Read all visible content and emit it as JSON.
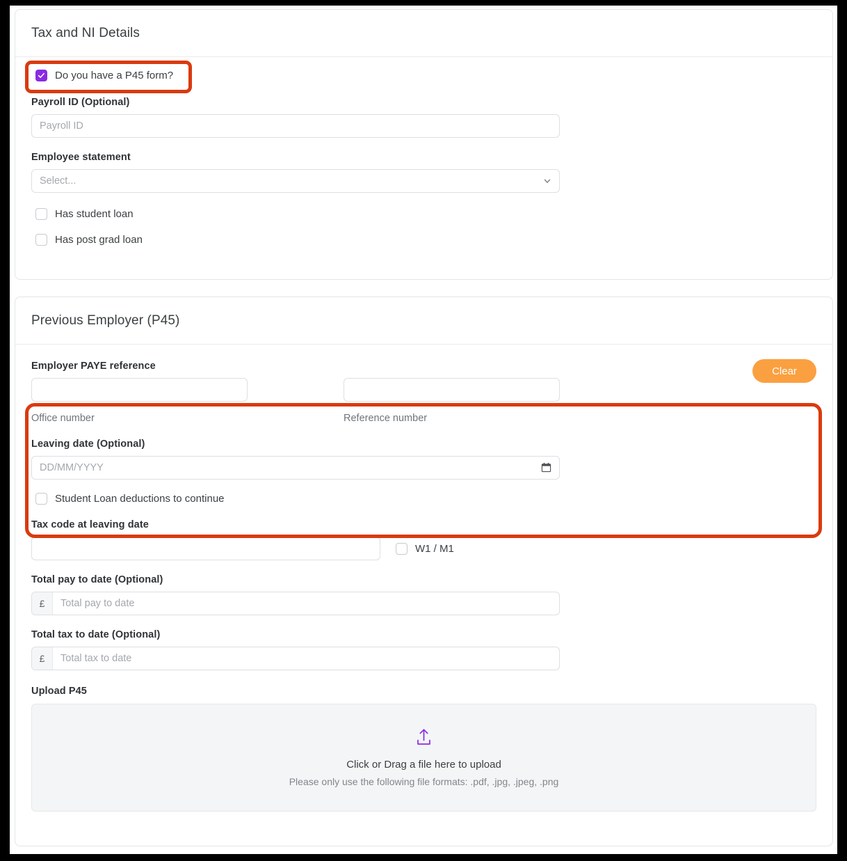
{
  "tax_card": {
    "title": "Tax and NI Details",
    "p45_checkbox": {
      "label": "Do you have a P45 form?",
      "checked": true,
      "check_glyph": "✓"
    },
    "payroll_id": {
      "label": "Payroll ID (Optional)",
      "placeholder": "Payroll ID",
      "value": ""
    },
    "employee_statement": {
      "label": "Employee statement",
      "selected": "Select...",
      "chevron": "chevron-down-icon"
    },
    "checkboxes": [
      {
        "label": "Has student loan",
        "checked": false
      },
      {
        "label": "Has post grad loan",
        "checked": false
      }
    ]
  },
  "previous_employer_card": {
    "title": "Previous Employer (P45)",
    "clear_button": "Clear",
    "paye_reference": {
      "label": "Employer PAYE reference",
      "office_number": {
        "value": "",
        "caption": "Office number"
      },
      "reference_number": {
        "value": "",
        "caption": "Reference number"
      }
    },
    "leaving_date": {
      "label": "Leaving date (Optional)",
      "placeholder": "DD/MM/YYYY",
      "value": ""
    },
    "student_loan_continue": {
      "label": "Student Loan deductions to continue",
      "checked": false
    },
    "tax_code": {
      "label": "Tax code at leaving date",
      "value": "",
      "w1m1": {
        "label": "W1 / M1",
        "checked": false
      }
    },
    "total_pay": {
      "label": "Total pay to date (Optional)",
      "currency": "£",
      "placeholder": "Total pay to date",
      "value": ""
    },
    "total_tax": {
      "label": "Total tax to date (Optional)",
      "currency": "£",
      "placeholder": "Total tax to date",
      "value": ""
    },
    "upload": {
      "label": "Upload P45",
      "icon": "upload-icon",
      "main_text": "Click or Drag a file here to upload",
      "sub_text": "Please only use the following file formats: .pdf, .jpg, .jpeg, .png"
    }
  },
  "colors": {
    "accent_purple": "#8a2be2",
    "clear_button_orange": "#fba040",
    "annotation_red": "#da3a0e",
    "text_dark": "#3c4043",
    "text_muted": "#81868c",
    "border_grey": "#dcdfe3"
  }
}
